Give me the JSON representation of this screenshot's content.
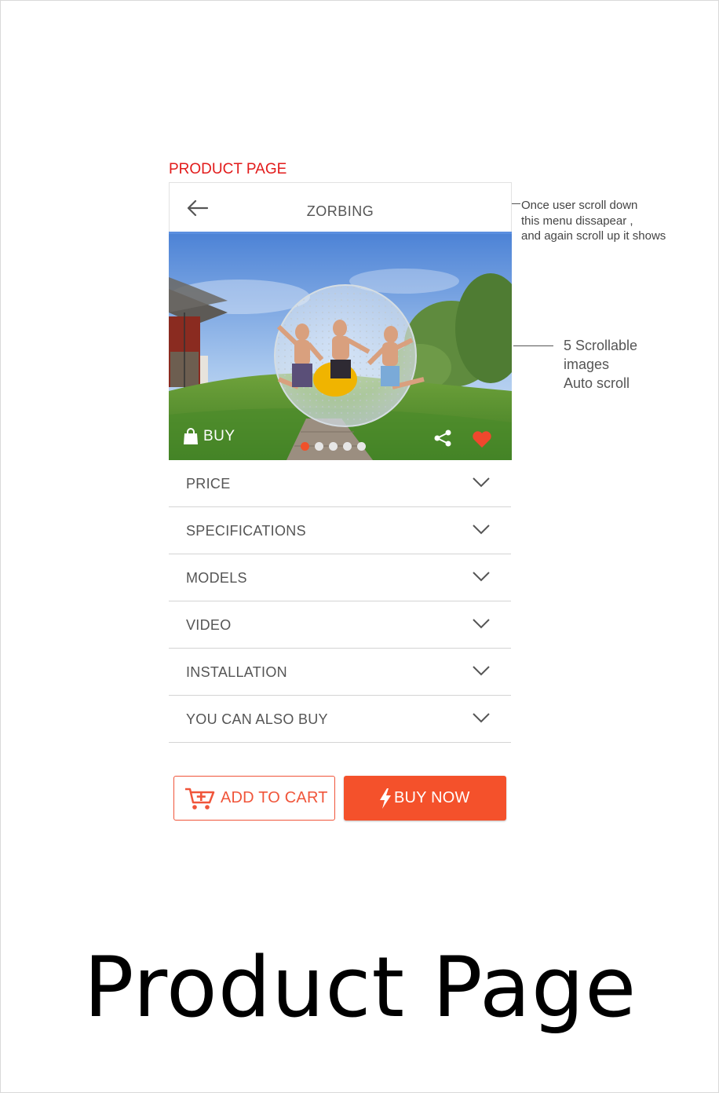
{
  "section_label": "PRODUCT PAGE",
  "topbar": {
    "title": "ZORBING",
    "back_icon": "arrow-left-icon"
  },
  "hero": {
    "buy_label": "BUY",
    "image_count": 5,
    "active_image": 1,
    "icons": {
      "buy": "shopping-bag-icon",
      "share": "share-icon",
      "favorite": "heart-icon"
    }
  },
  "accordion": [
    {
      "label": "PRICE"
    },
    {
      "label": "SPECIFICATIONS"
    },
    {
      "label": "MODELS"
    },
    {
      "label": "VIDEO"
    },
    {
      "label": "INSTALLATION"
    },
    {
      "label": "YOU CAN ALSO BUY"
    }
  ],
  "actions": {
    "add_to_cart": "ADD TO CART",
    "buy_now": "BUY NOW"
  },
  "annotations": {
    "menu_note": "Once user scroll down\nthis menu dissapear ,\nand again scroll up it shows",
    "images_note": "5 Scrollable\n images\nAuto scroll"
  },
  "caption": "Product Page",
  "colors": {
    "accent": "#f4512b",
    "label_red": "#e21b1b",
    "header_line": "#5b8fe0",
    "heart": "#f0472d"
  }
}
